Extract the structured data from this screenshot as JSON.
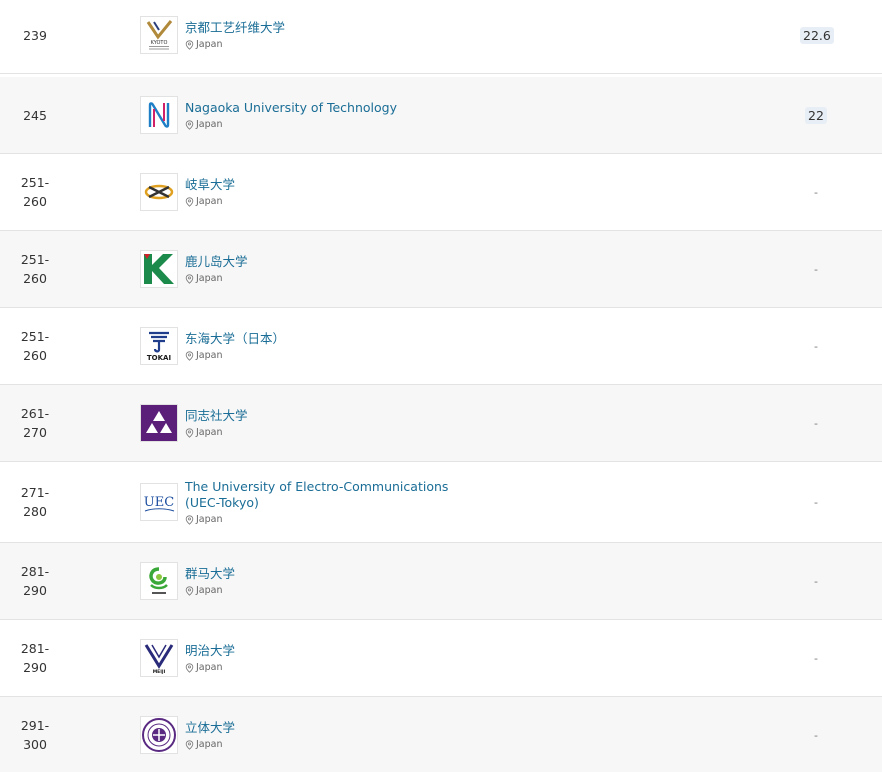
{
  "location_label": "Japan",
  "rows": [
    {
      "rank": "239",
      "name": "京都工艺纤维大学",
      "location": "Japan",
      "score": "22.6",
      "logo": "kyoto-it-logo"
    },
    {
      "rank": "245",
      "name": "Nagaoka University of Technology",
      "location": "Japan",
      "score": "22",
      "logo": "nagaoka-logo"
    },
    {
      "rank": "251-\n260",
      "name": "岐阜大学",
      "location": "Japan",
      "score": "-",
      "logo": "gifu-logo"
    },
    {
      "rank": "251-\n260",
      "name": "鹿儿岛大学",
      "location": "Japan",
      "score": "-",
      "logo": "kagoshima-logo"
    },
    {
      "rank": "251-\n260",
      "name": "东海大学（日本）",
      "location": "Japan",
      "score": "-",
      "logo": "tokai-logo"
    },
    {
      "rank": "261-\n270",
      "name": "同志社大学",
      "location": "Japan",
      "score": "-",
      "logo": "doshisha-logo"
    },
    {
      "rank": "271-\n280",
      "name": "The University of Electro-Communications (UEC-Tokyo)",
      "location": "Japan",
      "score": "-",
      "logo": "uec-logo"
    },
    {
      "rank": "281-\n290",
      "name": "群马大学",
      "location": "Japan",
      "score": "-",
      "logo": "gunma-logo"
    },
    {
      "rank": "281-\n290",
      "name": "明治大学",
      "location": "Japan",
      "score": "-",
      "logo": "meiji-logo"
    },
    {
      "rank": "291-\n300",
      "name": "立体大学",
      "location": "Japan",
      "score": "-",
      "logo": "rikkyo-logo"
    }
  ],
  "logo_text": {
    "kyoto": "KYOTO",
    "tokai": "TOKAI",
    "uec": "UEC",
    "meiji": "MEIJI"
  },
  "colors": {
    "link": "#1a6d96",
    "badge_bg": "#e8eef6",
    "row_alt": "#f7f7f7",
    "divider": "#e3e3e3",
    "doshisha_purple": "#5b1f7a",
    "kagoshima_green": "#1b8a4a",
    "rikkyo_purple": "#5a2a82"
  }
}
